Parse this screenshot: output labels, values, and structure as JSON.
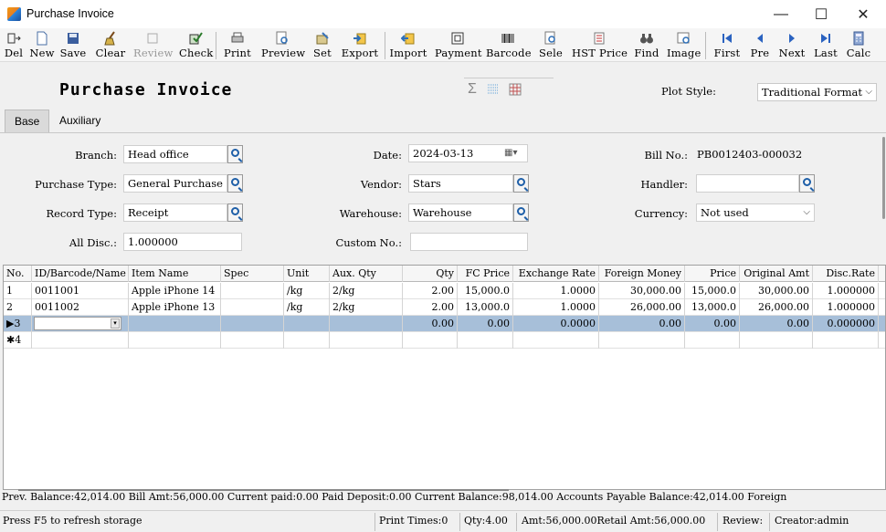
{
  "window": {
    "title": "Purchase Invoice",
    "minimize": "—",
    "maximize": "☐",
    "close": "✕"
  },
  "toolbar": [
    {
      "label": "Del",
      "icon": "delete-icon",
      "glyph": "⇥"
    },
    {
      "label": "New",
      "icon": "new-document-icon",
      "glyph": "🗋"
    },
    {
      "label": "Save",
      "icon": "save-icon",
      "glyph": "💾"
    },
    {
      "label": "Clear",
      "icon": "broom-icon",
      "glyph": "🧹"
    },
    {
      "label": "Review",
      "icon": "review-icon",
      "glyph": "✎"
    },
    {
      "label": "Check",
      "icon": "check-icon",
      "glyph": "✔"
    },
    {
      "label": "Print",
      "icon": "printer-icon",
      "glyph": "🖶"
    },
    {
      "label": "Preview",
      "icon": "preview-icon",
      "glyph": "🔍"
    },
    {
      "label": "Set",
      "icon": "settings-icon",
      "glyph": "⚙"
    },
    {
      "label": "Export",
      "icon": "export-icon",
      "glyph": "⇨"
    },
    {
      "label": "Import",
      "icon": "import-icon",
      "glyph": "⇦"
    },
    {
      "label": "Payment",
      "icon": "payment-icon",
      "glyph": "▣"
    },
    {
      "label": "Barcode",
      "icon": "barcode-icon",
      "glyph": "▥"
    },
    {
      "label": "Sele",
      "icon": "select-icon",
      "glyph": "🔎"
    },
    {
      "label": "HST Price",
      "icon": "history-price-icon",
      "glyph": "▤"
    },
    {
      "label": "Find",
      "icon": "binoculars-icon",
      "glyph": "👓"
    },
    {
      "label": "Image",
      "icon": "image-icon",
      "glyph": "🖼"
    },
    {
      "label": "First",
      "icon": "first-record-icon",
      "glyph": "⏮"
    },
    {
      "label": "Pre",
      "icon": "previous-record-icon",
      "glyph": "◀"
    },
    {
      "label": "Next",
      "icon": "next-record-icon",
      "glyph": "▶"
    },
    {
      "label": "Last",
      "icon": "last-record-icon",
      "glyph": "⏭"
    },
    {
      "label": "Calc",
      "icon": "calculator-icon",
      "glyph": "🖩"
    }
  ],
  "header": {
    "form_title": "Purchase Invoice",
    "plot_style_label": "Plot Style:",
    "plot_style_value": "Traditional Format"
  },
  "tabs": {
    "base": "Base",
    "auxiliary": "Auxiliary"
  },
  "form": {
    "branch": {
      "label": "Branch:",
      "value": "Head office"
    },
    "purchase_type": {
      "label": "Purchase Type:",
      "value": "General Purchase"
    },
    "record_type": {
      "label": "Record Type:",
      "value": "Receipt"
    },
    "all_disc": {
      "label": "All Disc.:",
      "value": "1.000000"
    },
    "date": {
      "label": "Date:",
      "value": "2024-03-13"
    },
    "vendor": {
      "label": "Vendor:",
      "value": "Stars"
    },
    "warehouse": {
      "label": "Warehouse:",
      "value": "Warehouse"
    },
    "custom_no": {
      "label": "Custom No.:",
      "value": ""
    },
    "bill_no": {
      "label": "Bill No.:",
      "value": "PB0012403-000032"
    },
    "handler": {
      "label": "Handler:",
      "value": ""
    },
    "currency": {
      "label": "Currency:",
      "value": "Not used"
    }
  },
  "grid": {
    "columns": [
      "No.",
      "ID/Barcode/Name",
      "Item Name",
      "Spec",
      "Unit",
      "Aux. Qty",
      "Qty",
      "FC Price",
      "Exchange Rate",
      "Foreign Money",
      "Price",
      "Original Amt",
      "Disc.Rate"
    ],
    "rows": [
      [
        "1",
        "0011001",
        "Apple iPhone 14",
        "",
        "/kg",
        "2/kg",
        "2.00",
        "15,000.0",
        "1.0000",
        "30,000.00",
        "15,000.0",
        "30,000.00",
        "1.000000"
      ],
      [
        "2",
        "0011002",
        "Apple iPhone 13",
        "",
        "/kg",
        "2/kg",
        "2.00",
        "13,000.0",
        "1.0000",
        "26,000.00",
        "13,000.0",
        "26,000.00",
        "1.000000"
      ],
      [
        "▶3",
        "",
        "",
        "",
        "",
        "",
        "0.00",
        "0.00",
        "0.0000",
        "0.00",
        "0.00",
        "0.00",
        "0.000000"
      ],
      [
        "✱4",
        "",
        "",
        "",
        "",
        "",
        "",
        "",
        "",
        "",
        "",
        "",
        ""
      ]
    ]
  },
  "summary": "Prev. Balance:42,014.00 Bill Amt:56,000.00 Current paid:0.00 Paid Deposit:0.00 Current Balance:98,014.00 Accounts Payable Balance:42,014.00 Foreign",
  "status": {
    "hint": "Press F5 to refresh storage",
    "print_times": "Print Times:0",
    "qty": "Qty:4.00",
    "amt": "Amt:56,000.00Retail Amt:56,000.00",
    "review": "Review:",
    "creator": "Creator:admin"
  },
  "colors": {
    "selected_row": "#a7bfd9",
    "lookup_icon": "#1e5fa8"
  }
}
